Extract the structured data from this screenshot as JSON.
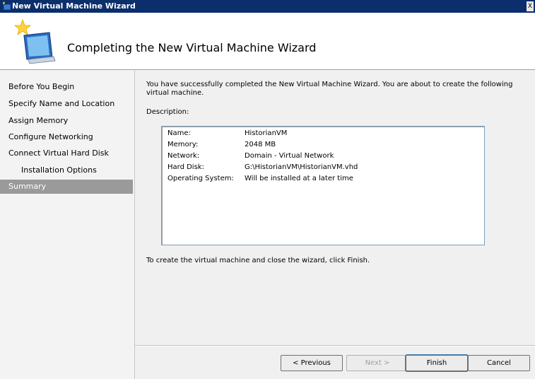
{
  "window": {
    "title": "New Virtual Machine Wizard",
    "close_glyph": "X"
  },
  "header": {
    "title": "Completing the New Virtual Machine Wizard"
  },
  "nav": {
    "items": [
      {
        "label": "Before You Begin"
      },
      {
        "label": "Specify Name and Location"
      },
      {
        "label": "Assign Memory"
      },
      {
        "label": "Configure Networking"
      },
      {
        "label": "Connect Virtual Hard Disk"
      },
      {
        "label": "Installation Options"
      },
      {
        "label": "Summary",
        "selected": true
      }
    ]
  },
  "main": {
    "intro": "You have successfully completed the New Virtual Machine Wizard. You are about to create the following virtual machine.",
    "description_label": "Description:",
    "summary": [
      {
        "key": "Name:",
        "value": "HistorianVM"
      },
      {
        "key": "Memory:",
        "value": "2048 MB"
      },
      {
        "key": "Network:",
        "value": "Domain - Virtual Network"
      },
      {
        "key": "Hard Disk:",
        "value": "G:\\HistorianVM\\HistorianVM.vhd"
      },
      {
        "key": "Operating System:",
        "value": "Will be installed at a later time"
      }
    ],
    "finish_note": "To create the virtual machine and close the wizard, click Finish."
  },
  "buttons": {
    "previous": "< Previous",
    "next": "Next >",
    "finish": "Finish",
    "cancel": "Cancel"
  },
  "colors": {
    "titlebar": "#0b2e6c",
    "selected_nav": "#9a9a9a",
    "background": "#f0f0f0"
  },
  "icons": {
    "title": "wizard-small-icon",
    "header": "wizard-large-icon"
  }
}
